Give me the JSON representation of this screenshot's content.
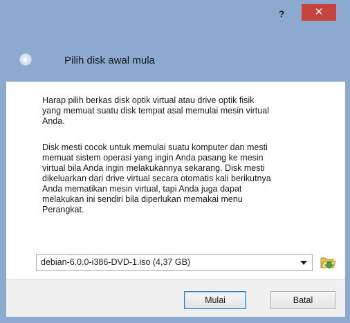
{
  "titlebar": {
    "help_label": "?",
    "close_label": "✕"
  },
  "header": {
    "title": "Pilih disk awal mula",
    "back_icon": "back-arrow-icon"
  },
  "content": {
    "paragraph1": "Harap pilih berkas disk optik virtual atau drive optik fisik\nyang memuat suatu disk tempat asal memulai mesin virtual\nAnda.",
    "paragraph2": "Disk mesti cocok untuk memulai suatu komputer dan mesti\nmemuat sistem operasi yang ingin Anda pasang ke mesin\nvirtual bila Anda ingin melakukannya sekarang. Disk mesti\ndikeluarkan dari drive virtual secara otomatis kali berikutnya\nAnda mematikan mesin virtual, tapi Anda juga dapat\nmelakukan ini sendiri bila diperlukan memakai menu\nPerangkat."
  },
  "media_select": {
    "selected": "debian-6.0.0-i386-DVD-1.iso (4,37 GB)",
    "browse_icon": "folder-open-icon"
  },
  "footer": {
    "start_label": "Mulai",
    "cancel_label": "Batal"
  },
  "colors": {
    "frame": "#8ca9d0",
    "close": "#c7443d"
  }
}
